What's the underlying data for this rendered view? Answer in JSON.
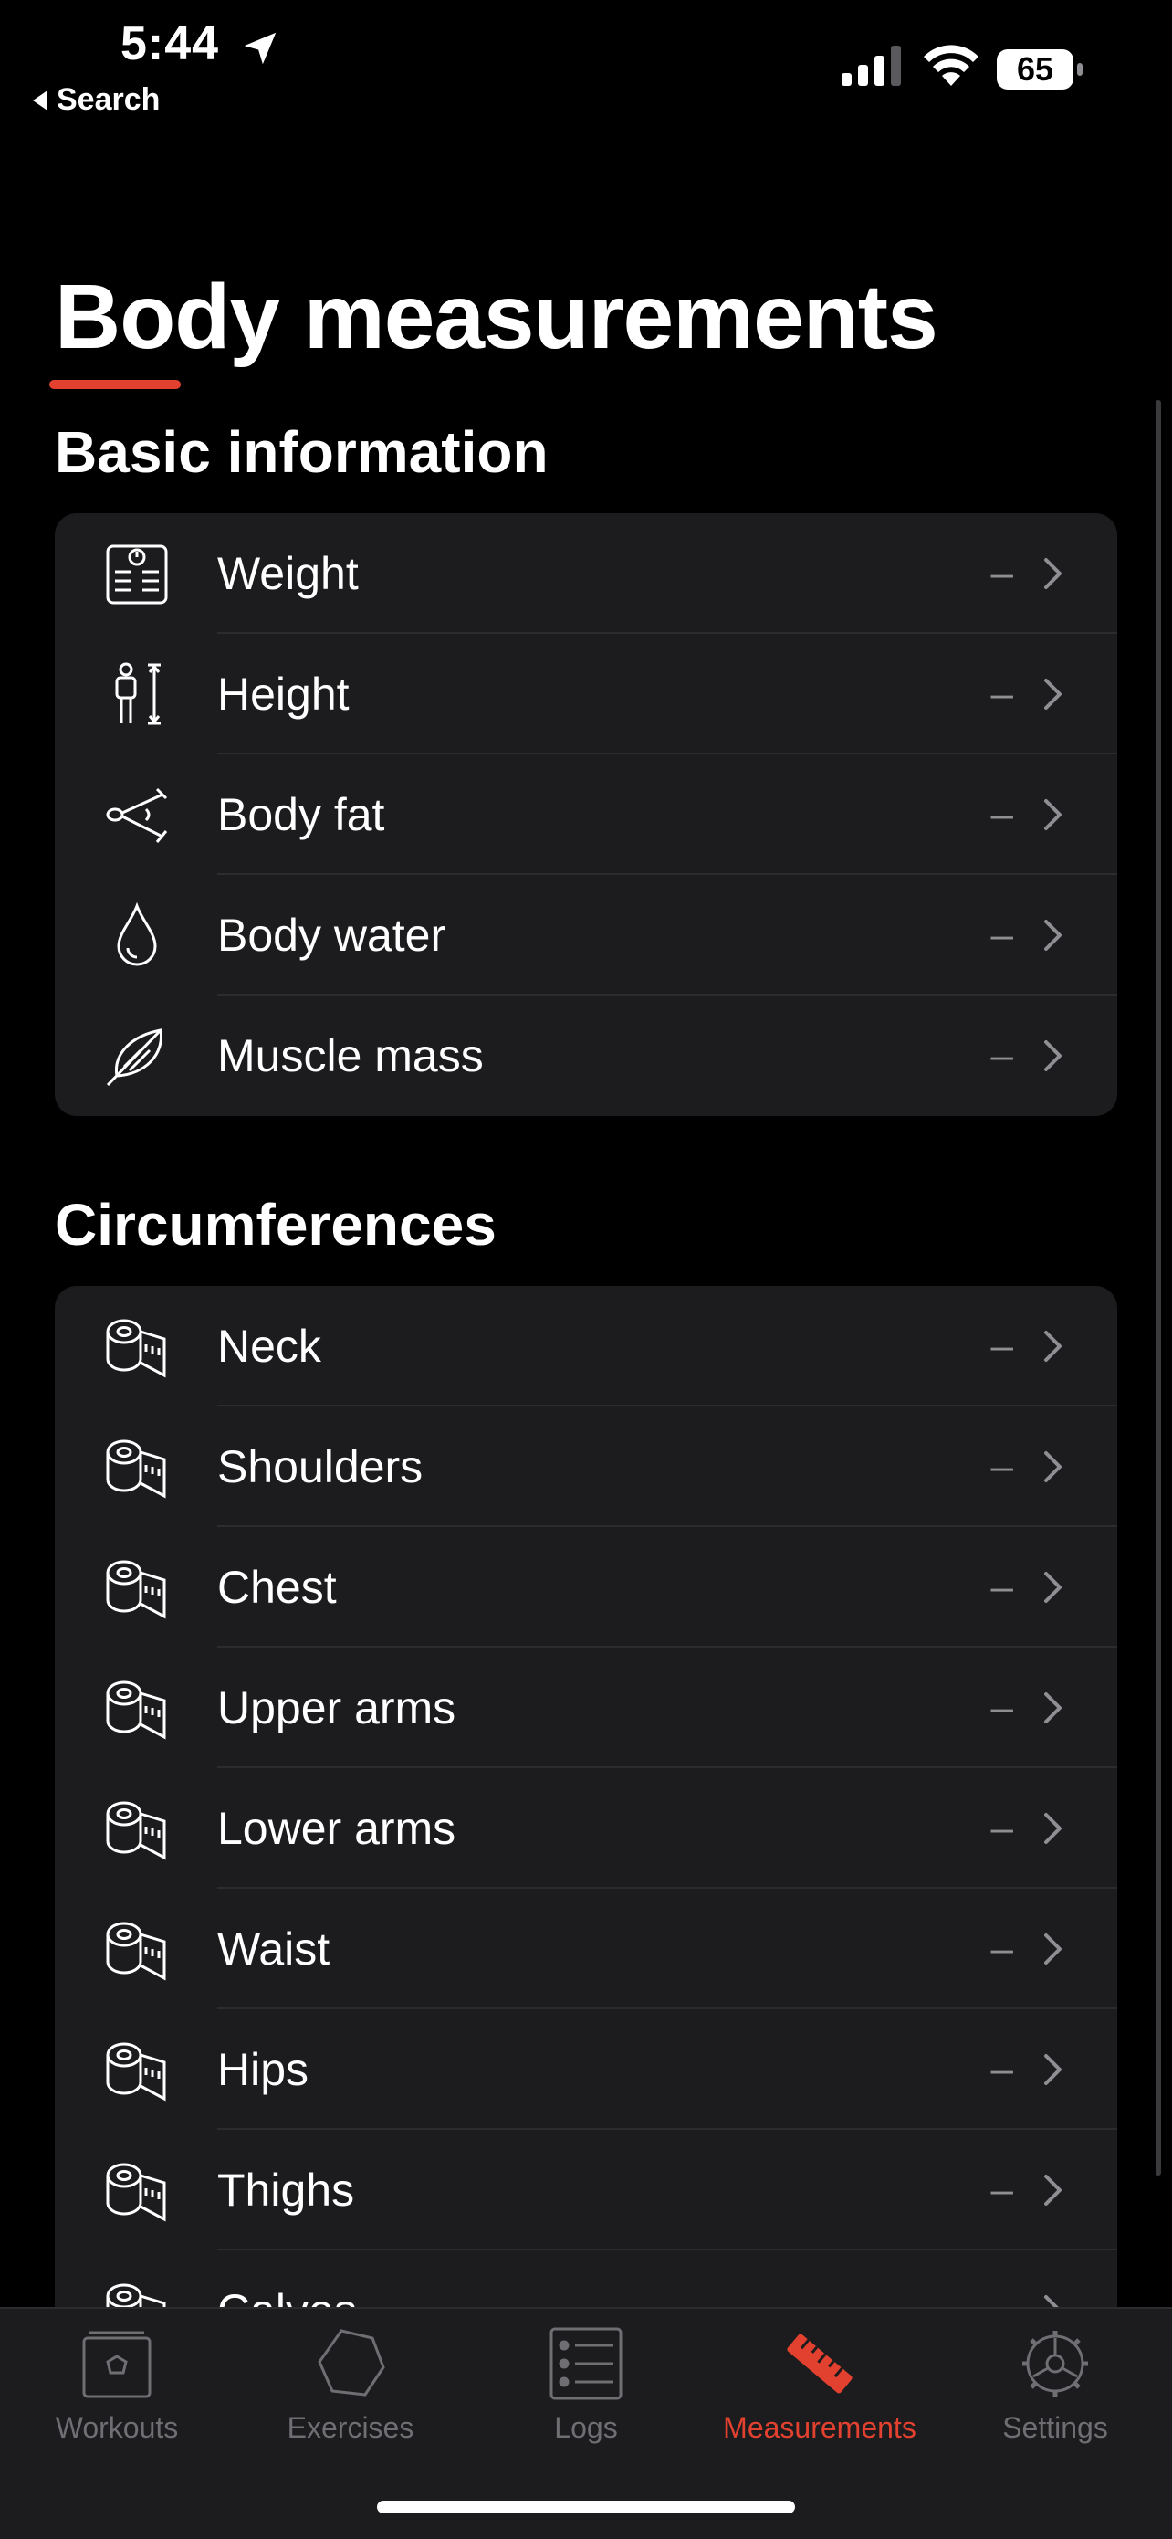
{
  "status_bar": {
    "time": "5:44",
    "battery": "65",
    "back_label": "Search"
  },
  "page": {
    "title": "Body measurements"
  },
  "sections": {
    "basic": {
      "title": "Basic information",
      "items": [
        {
          "label": "Weight",
          "value": "–",
          "icon": "scale-icon"
        },
        {
          "label": "Height",
          "value": "–",
          "icon": "height-icon"
        },
        {
          "label": "Body fat",
          "value": "–",
          "icon": "caliper-icon"
        },
        {
          "label": "Body water",
          "value": "–",
          "icon": "water-drop-icon"
        },
        {
          "label": "Muscle mass",
          "value": "–",
          "icon": "muscle-icon"
        }
      ]
    },
    "circumferences": {
      "title": "Circumferences",
      "items": [
        {
          "label": "Neck",
          "value": "–",
          "icon": "tape-measure-icon"
        },
        {
          "label": "Shoulders",
          "value": "–",
          "icon": "tape-measure-icon"
        },
        {
          "label": "Chest",
          "value": "–",
          "icon": "tape-measure-icon"
        },
        {
          "label": "Upper arms",
          "value": "–",
          "icon": "tape-measure-icon"
        },
        {
          "label": "Lower arms",
          "value": "–",
          "icon": "tape-measure-icon"
        },
        {
          "label": "Waist",
          "value": "–",
          "icon": "tape-measure-icon"
        },
        {
          "label": "Hips",
          "value": "–",
          "icon": "tape-measure-icon"
        },
        {
          "label": "Thighs",
          "value": "–",
          "icon": "tape-measure-icon"
        },
        {
          "label": "Calves",
          "value": "–",
          "icon": "tape-measure-icon"
        }
      ]
    }
  },
  "tab_bar": {
    "tabs": [
      {
        "label": "Workouts",
        "icon": "workouts-icon",
        "active": false
      },
      {
        "label": "Exercises",
        "icon": "hexagon-icon",
        "active": false
      },
      {
        "label": "Logs",
        "icon": "list-icon",
        "active": false
      },
      {
        "label": "Measurements",
        "icon": "ruler-icon",
        "active": true
      },
      {
        "label": "Settings",
        "icon": "gear-icon",
        "active": false
      }
    ]
  },
  "colors": {
    "accent": "#e2412f",
    "card": "#1c1c1e",
    "background": "#000000",
    "muted": "#8e8e93"
  }
}
